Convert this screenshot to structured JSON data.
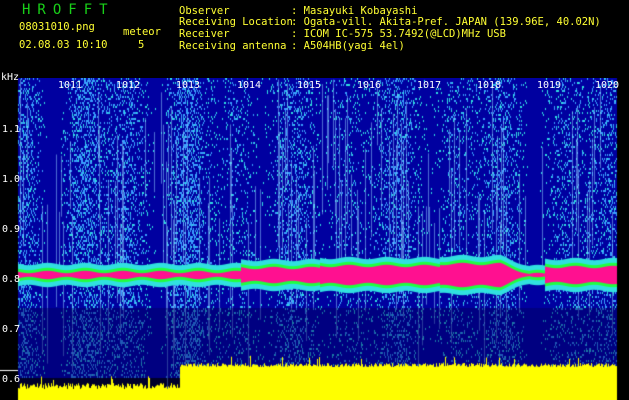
{
  "header": {
    "program": "HROFFT",
    "filename": "08031010.png",
    "meteor_label": "meteor",
    "datetime": "02.08.03 10:10",
    "meteor_count": "5",
    "fields": [
      {
        "label": "Observer",
        "value": ": Masayuki Kobayashi"
      },
      {
        "label": "Receiving Location",
        "value": ": Ogata-vill. Akita-Pref. JAPAN (139.96E, 40.02N)"
      },
      {
        "label": "Receiver",
        "value": ": ICOM IC-575 53.7492(@LCD)MHz USB"
      },
      {
        "label": "Receiving antenna",
        "value": ": A504HB(yagi 4el)"
      }
    ]
  },
  "spectrogram": {
    "y_axis_unit": "kHz",
    "y_ticks": [
      "1.1",
      "1.0",
      "0.9",
      "0.8",
      "0.7",
      "0.6"
    ],
    "time_ticks": [
      "1011",
      "1012",
      "1013",
      "1014",
      "1015",
      "1016",
      "1017",
      "1018",
      "1019",
      "1020"
    ],
    "colors": {
      "background": "#0000a0",
      "noise_light": "#3aa0ff",
      "noise_cyan": "#30e0e0",
      "echo_green": "#20ff40",
      "echo_core": "#ff1090",
      "signal_level": "#ffff00"
    }
  }
}
